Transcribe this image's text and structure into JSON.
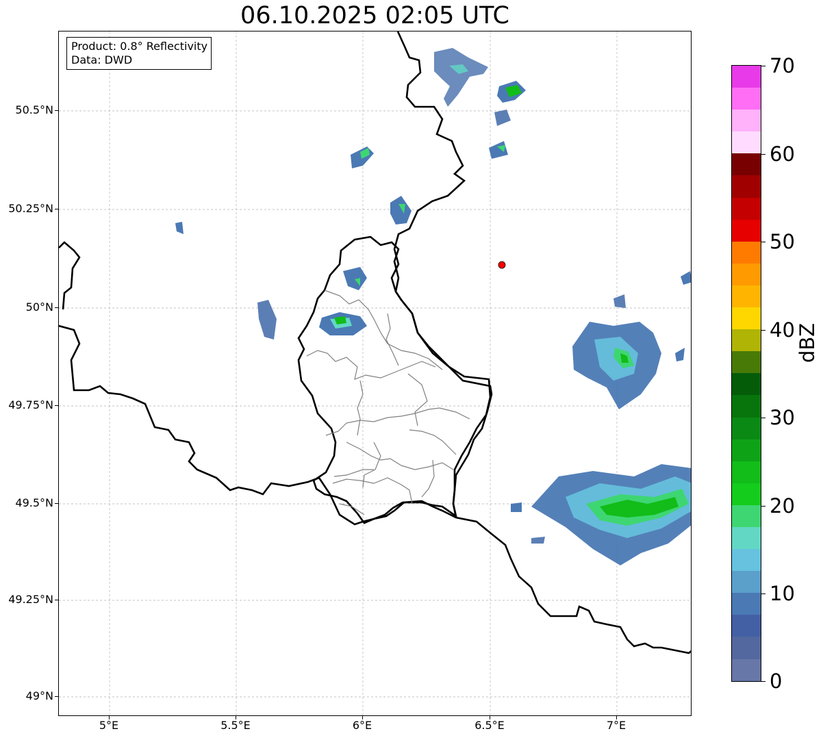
{
  "title": "06.10.2025 02:05 UTC",
  "info": {
    "product": "Product: 0.8° Reflectivity",
    "data": "Data: DWD"
  },
  "axes": {
    "lat_ticks": [
      "50.5°N",
      "50.25°N",
      "50°N",
      "49.75°N",
      "49.5°N",
      "49.25°N",
      "49°N"
    ],
    "lon_ticks": [
      "5°E",
      "5.5°E",
      "6°E",
      "6.5°E",
      "7°E"
    ]
  },
  "radar_site_marker": {
    "color": "#ff0000"
  },
  "colorbar": {
    "label": "dBZ",
    "ticks": [
      "70",
      "60",
      "50",
      "40",
      "30",
      "20",
      "10",
      "0"
    ],
    "colors_top_to_bottom": [
      "#e83ae8",
      "#ff6ef5",
      "#ffb1fa",
      "#ffdcff",
      "#780000",
      "#a00000",
      "#c40000",
      "#e60000",
      "#ff7b00",
      "#ff9a00",
      "#ffb500",
      "#ffd700",
      "#b0b404",
      "#487a07",
      "#045c09",
      "#08750c",
      "#0a8914",
      "#0ea316",
      "#12bc19",
      "#14cc1c",
      "#3ed672",
      "#62d8c4",
      "#66c2de",
      "#5b9fcb",
      "#4b79b4",
      "#4460a5",
      "#53689e",
      "#6677a8"
    ]
  }
}
